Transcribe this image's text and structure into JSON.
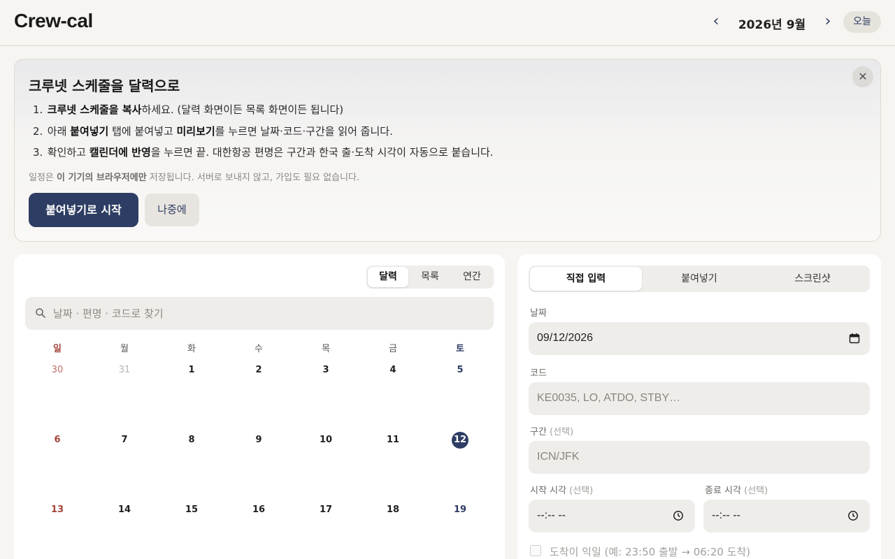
{
  "header": {
    "brand": "Crew-cal",
    "month": "2026년 9월",
    "prev": "‹",
    "next": "›",
    "today": "오늘"
  },
  "banner": {
    "title": "크루넷 스케줄을 달력으로",
    "close": "✕",
    "steps": [
      {
        "num": "1.",
        "b1": "크루넷 스케줄을 복사",
        "t1": "하세요. (달력 화면이든 목록 화면이든 됩니다)"
      },
      {
        "num": "2.",
        "t0": "아래 ",
        "b1": "붙여넣기",
        "t1": " 탭에 붙여넣고 ",
        "b2": "미리보기",
        "t2": "를 누르면 날짜·코드·구간을 읽어 줍니다."
      },
      {
        "num": "3.",
        "t0": "확인하고 ",
        "b1": "캘린더에 반영",
        "t1": "을 누르면 끝. 대한항공 편명은 구간과 한국 출·도착 시각이 자동으로 붙습니다."
      }
    ],
    "note_pre": "일정은 ",
    "note_bold": "이 기기의 브라우저에만",
    "note_post": " 저장됩니다. 서버로 보내지 않고, 가입도 필요 없습니다.",
    "start_button": "붙여넣기로 시작",
    "later_button": "나중에"
  },
  "calendar": {
    "views": [
      "달력",
      "목록",
      "연간"
    ],
    "active_view": 0,
    "search_placeholder": "날짜 · 편명 · 코드로 찾기",
    "weekdays": [
      "일",
      "월",
      "화",
      "수",
      "목",
      "금",
      "토"
    ],
    "days": [
      {
        "n": "30",
        "out": true
      },
      {
        "n": "31",
        "out": true
      },
      {
        "n": "1"
      },
      {
        "n": "2"
      },
      {
        "n": "3"
      },
      {
        "n": "4"
      },
      {
        "n": "5"
      },
      {
        "n": "6"
      },
      {
        "n": "7"
      },
      {
        "n": "8"
      },
      {
        "n": "9"
      },
      {
        "n": "10"
      },
      {
        "n": "11"
      },
      {
        "n": "12",
        "selected": true
      },
      {
        "n": "13"
      },
      {
        "n": "14"
      },
      {
        "n": "15"
      },
      {
        "n": "16"
      },
      {
        "n": "17"
      },
      {
        "n": "18"
      },
      {
        "n": "19"
      }
    ]
  },
  "form": {
    "tabs": [
      "직접 입력",
      "붙여넣기",
      "스크린샷"
    ],
    "active_tab": 0,
    "date_label": "날짜",
    "date_value": "09/12/2026",
    "code_label": "코드",
    "code_placeholder": "KE0035, LO, ATDO, STBY…",
    "route_label": "구간",
    "route_optional": " (선택)",
    "route_placeholder": "ICN/JFK",
    "start_label": "시작 시각",
    "start_optional": " (선택)",
    "start_value": "--:-- --",
    "end_label": "종료 시각",
    "end_optional": " (선택)",
    "end_value": "--:-- --",
    "overnight_label": "도착이 익일 (예: 23:50 출발 → 06:20 도착)"
  },
  "colors": {
    "accent": "#2e3d63",
    "sunday": "#a4433a",
    "background": "#f7f5f1"
  }
}
